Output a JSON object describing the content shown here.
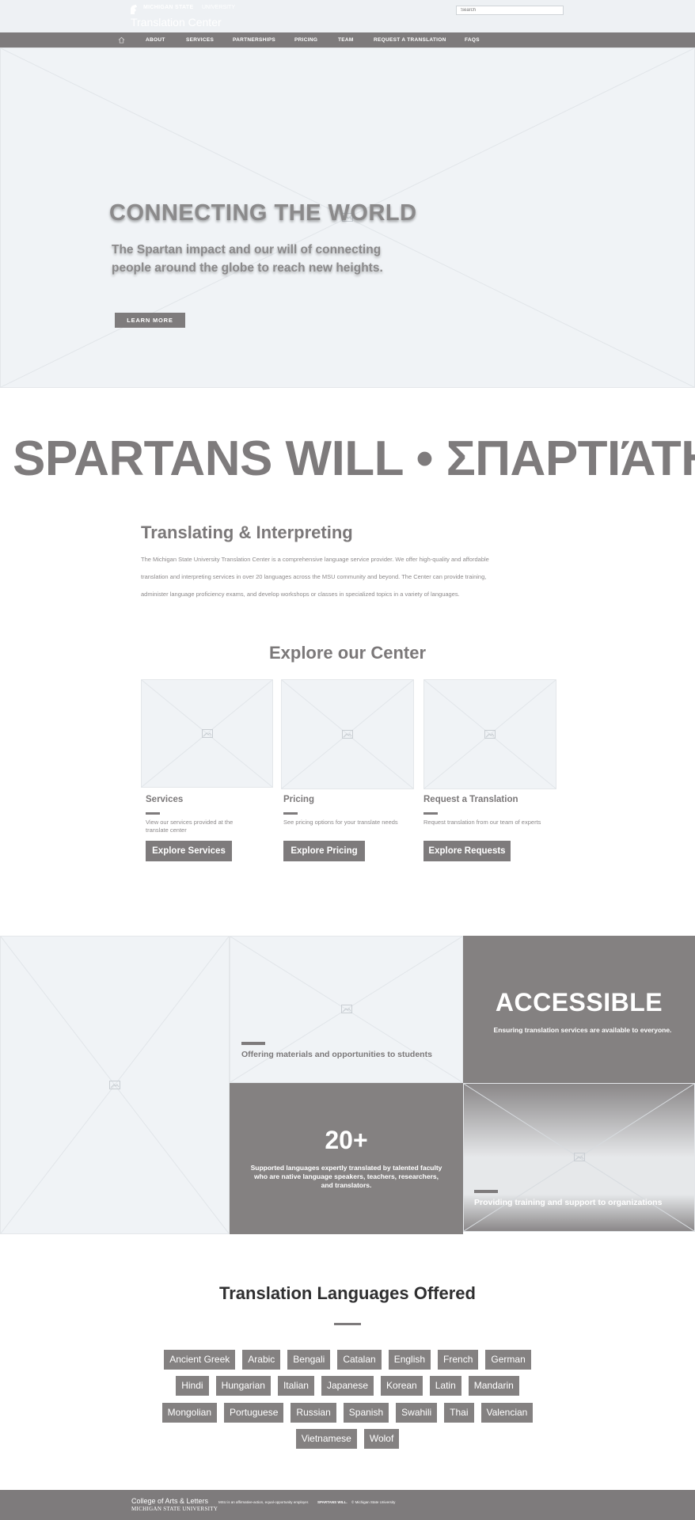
{
  "header": {
    "university": "MICHIGAN STATE",
    "university_sub": "UNIVERSITY",
    "site_title": "Translation Center",
    "search_placeholder": "Search"
  },
  "nav": {
    "items": [
      "ABOUT",
      "SERVICES",
      "PARTNERSHIPS",
      "PRICING",
      "TEAM",
      "REQUEST A TRANSLATION",
      "FAQS"
    ]
  },
  "hero": {
    "title": "CONNECTING THE WORLD",
    "subtitle_line1": "The Spartan impact and our will of connecting",
    "subtitle_line2": "people around the globe to reach new heights.",
    "cta": "LEARN  MORE"
  },
  "marquee": {
    "text": "SPARTANS WILL • ΣΠΑΡΤΙΆΤΗΣ ΘΑ"
  },
  "intro": {
    "title": "Translating & Interpreting",
    "lines": [
      "The Michigan State University Translation Center is a comprehensive language service provider. We offer high-quality and affordable",
      "translation and interpreting services in over 20 languages across the MSU community and beyond. The Center can provide training,",
      "administer language proficiency exams, and develop workshops or classes in specialized topics in a variety of languages."
    ]
  },
  "explore": {
    "title": "Explore our Center",
    "cards": [
      {
        "title": "Services",
        "desc": "View our services provided at the translate center",
        "button": "Explore Services"
      },
      {
        "title": "Pricing",
        "desc": "See pricing options for your translate needs",
        "button": "Explore Pricing"
      },
      {
        "title": "Request a Translation",
        "desc": "Request translation from our team of experts",
        "button": "Explore Requests"
      }
    ]
  },
  "features": {
    "accessible_title": "ACCESSIBLE",
    "accessible_sub": "Ensuring translation services are available to everyone.",
    "count_title": "20+",
    "count_sub": "Supported languages expertly translated by talented faculty who are native language speakers, teachers, researchers, and translators.",
    "offering": "Offering materials and opportunities to students",
    "training": "Providing training and support to organizations"
  },
  "languages": {
    "title": "Translation Languages Offered",
    "rows": [
      [
        "Ancient Greek",
        "Arabic",
        "Bengali",
        "Catalan",
        "English",
        "French",
        "German"
      ],
      [
        "Hindi",
        "Hungarian",
        "Italian",
        "Japanese",
        "Korean",
        "Latin",
        "Mandarin"
      ],
      [
        "Mongolian",
        "Portuguese",
        "Russian",
        "Spanish",
        "Swahili",
        "Thai",
        "Valencian"
      ],
      [
        "Vietnamese",
        "Wolof"
      ]
    ]
  },
  "footer": {
    "college": "College of Arts & Letters",
    "university": "MICHIGAN STATE UNIVERSITY",
    "eeo": "MSU is an affirmative-action, equal-opportunity employer.",
    "tagline": "SPARTANS WILL.",
    "copyright": "© Michigan State University"
  },
  "colors": {
    "gray": "#7e7b7c",
    "placeholder": "#f0f3f6",
    "heading_dark": "#2f2f30"
  }
}
